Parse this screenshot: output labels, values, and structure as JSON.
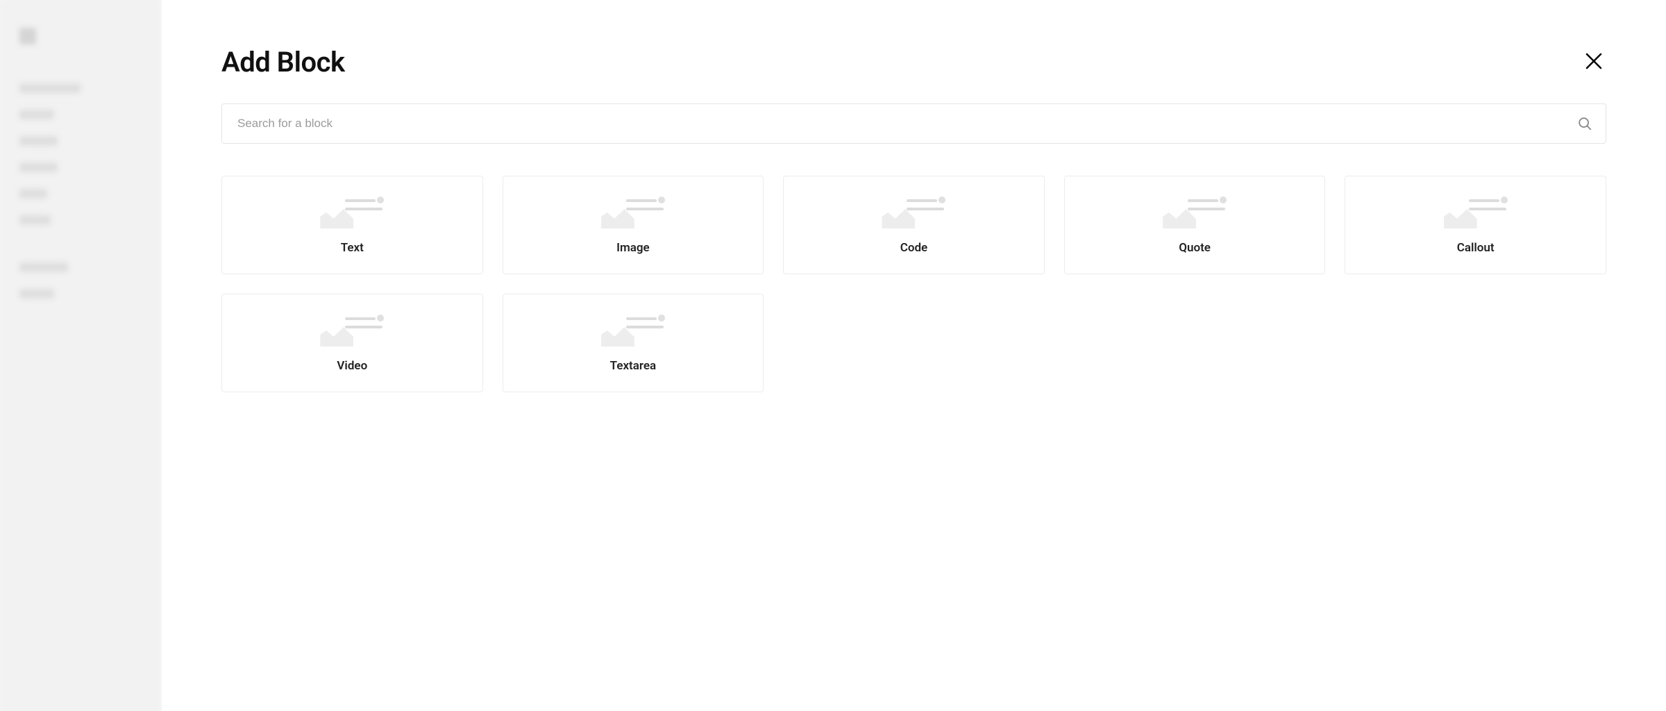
{
  "modal": {
    "title": "Add Block",
    "search_placeholder": "Search for a block"
  },
  "blocks": [
    {
      "label": "Text"
    },
    {
      "label": "Image"
    },
    {
      "label": "Code"
    },
    {
      "label": "Quote"
    },
    {
      "label": "Callout"
    },
    {
      "label": "Video"
    },
    {
      "label": "Textarea"
    }
  ]
}
